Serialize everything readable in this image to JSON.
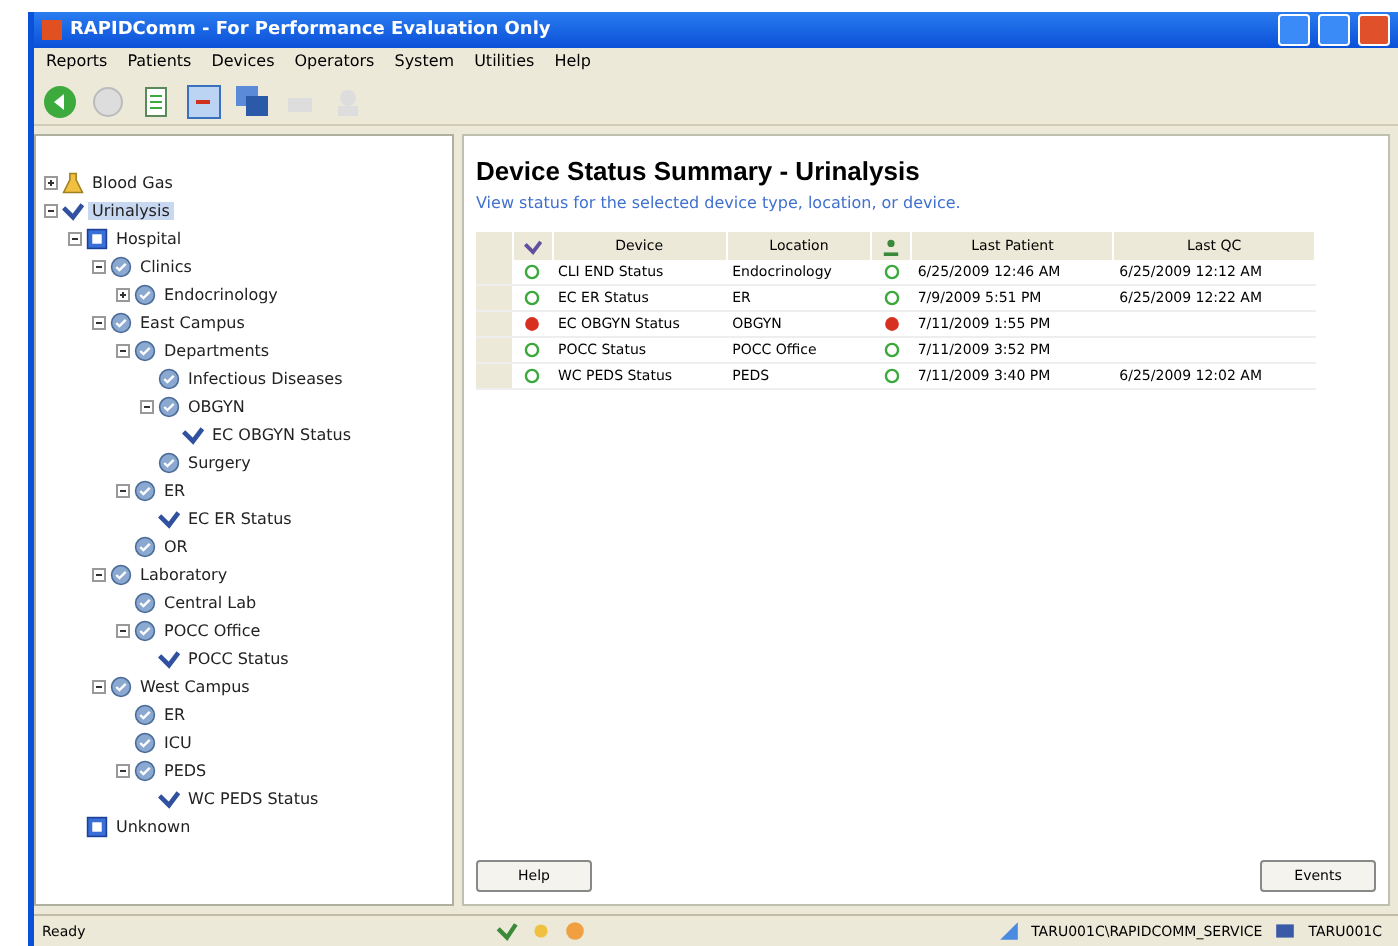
{
  "window": {
    "title": "RAPIDComm - For Performance Evaluation Only"
  },
  "menu": [
    "Reports",
    "Patients",
    "Devices",
    "Operators",
    "System",
    "Utilities",
    "Help"
  ],
  "tree": [
    {
      "label": "Blood Gas",
      "kind": "analyzer",
      "expanded": false,
      "selected": false
    },
    {
      "label": "Urinalysis",
      "kind": "device",
      "expanded": true,
      "selected": true,
      "children": [
        {
          "label": "Hospital",
          "kind": "site",
          "expanded": true,
          "selected": false,
          "children": [
            {
              "label": "Clinics",
              "kind": "location",
              "expanded": true,
              "selected": false,
              "children": [
                {
                  "label": "Endocrinology",
                  "kind": "location",
                  "expanded": false,
                  "selected": false
                }
              ]
            },
            {
              "label": "East Campus",
              "kind": "location",
              "expanded": true,
              "selected": false,
              "children": [
                {
                  "label": "Departments",
                  "kind": "location",
                  "expanded": true,
                  "selected": false,
                  "children": [
                    {
                      "label": "Infectious Diseases",
                      "kind": "location",
                      "selected": false
                    },
                    {
                      "label": "OBGYN",
                      "kind": "location",
                      "expanded": true,
                      "selected": false,
                      "children": [
                        {
                          "label": "EC OBGYN Status",
                          "kind": "device",
                          "selected": false
                        }
                      ]
                    },
                    {
                      "label": "Surgery",
                      "kind": "location",
                      "selected": false
                    }
                  ]
                },
                {
                  "label": "ER",
                  "kind": "location",
                  "expanded": true,
                  "selected": false,
                  "children": [
                    {
                      "label": "EC ER Status",
                      "kind": "device",
                      "selected": false
                    }
                  ]
                },
                {
                  "label": "OR",
                  "kind": "location",
                  "selected": false
                }
              ]
            },
            {
              "label": "Laboratory",
              "kind": "location",
              "expanded": true,
              "selected": false,
              "children": [
                {
                  "label": "Central Lab",
                  "kind": "location",
                  "selected": false
                },
                {
                  "label": "POCC Office",
                  "kind": "location",
                  "expanded": true,
                  "selected": false,
                  "children": [
                    {
                      "label": "POCC Status",
                      "kind": "device",
                      "selected": false
                    }
                  ]
                }
              ]
            },
            {
              "label": "West Campus",
              "kind": "location",
              "expanded": true,
              "selected": false,
              "children": [
                {
                  "label": "ER",
                  "kind": "location",
                  "selected": false
                },
                {
                  "label": "ICU",
                  "kind": "location",
                  "selected": false
                },
                {
                  "label": "PEDS",
                  "kind": "location",
                  "expanded": true,
                  "selected": false,
                  "children": [
                    {
                      "label": "WC PEDS Status",
                      "kind": "device",
                      "selected": false
                    }
                  ]
                }
              ]
            }
          ]
        },
        {
          "label": "Unknown",
          "kind": "site",
          "selected": false
        }
      ]
    }
  ],
  "content": {
    "title": "Device Status Summary - Urinalysis",
    "subtitle": "View status for the selected device type, location, or device.",
    "columns": [
      "Device",
      "Location",
      "Last Patient",
      "Last QC"
    ],
    "rows": [
      {
        "device_alert": false,
        "device": "CLI END Status",
        "location": "Endocrinology",
        "operator_alert": false,
        "last_patient": "6/25/2009 12:46 AM",
        "last_qc": "6/25/2009 12:12 AM"
      },
      {
        "device_alert": false,
        "device": "EC ER Status",
        "location": "ER",
        "operator_alert": false,
        "last_patient": "7/9/2009 5:51 PM",
        "last_qc": "6/25/2009 12:22 AM"
      },
      {
        "device_alert": true,
        "device": "EC OBGYN Status",
        "location": "OBGYN",
        "operator_alert": true,
        "last_patient": "7/11/2009 1:55 PM"
      },
      {
        "device_alert": false,
        "device": "POCC Status",
        "location": "POCC Office",
        "operator_alert": false,
        "last_patient": "7/11/2009 3:52 PM"
      },
      {
        "device_alert": false,
        "device": "WC PEDS Status",
        "location": "PEDS",
        "operator_alert": false,
        "last_patient": "7/11/2009 3:40 PM",
        "last_qc": "6/25/2009 12:02 AM"
      }
    ],
    "buttons": [
      "Help",
      "Events"
    ]
  },
  "status_bar": {
    "text": "Ready",
    "user": "TARU001C\\RAPIDCOMM_SERVICE",
    "machine": "TARU001C"
  }
}
